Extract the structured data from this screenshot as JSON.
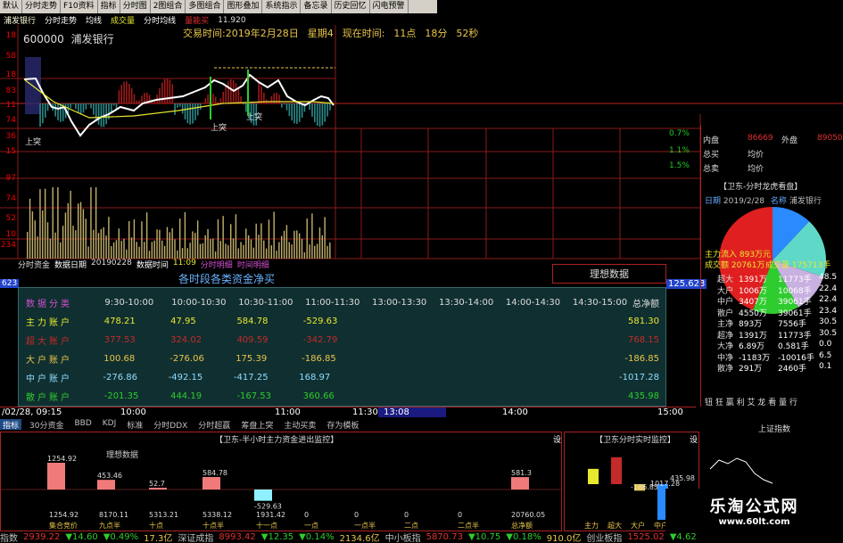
{
  "menu": [
    "默认",
    "分时走势",
    "F10资料",
    "指标",
    "分时图",
    "2图组合",
    "多图组合",
    "图形叠加",
    "系统指示",
    "备忘录",
    "历史回忆",
    "闪电预警"
  ],
  "titlebar": {
    "stock": "浦发银行",
    "items": [
      "分时走势",
      "均线",
      "成交量",
      "分时均线",
      "量能买"
    ],
    "price": "11.920"
  },
  "stock": {
    "code": "600000",
    "name": "浦发银行"
  },
  "tradeinfo": {
    "date_label": "交易时间:2019年2月28日",
    "weekday": "星期4",
    "now_label": "现在时间:",
    "hour": "11点",
    "minute": "18分",
    "second": "52秒"
  },
  "left_axis": [
    "18",
    "58",
    "18",
    "83",
    "11",
    "74",
    "36",
    "15",
    "97",
    "74",
    "52",
    "10",
    "234"
  ],
  "pct_labels": [
    "0.7%",
    "1.1%",
    "1.5%"
  ],
  "annot": {
    "up1": "上突",
    "up2": "上突",
    "up3": "上突"
  },
  "subheader": {
    "item1": "分时资金",
    "item2": "数据日期",
    "date": "20190228",
    "item3": "数据时间",
    "time": "11:09",
    "item4": "分时明细",
    "item5": "时间明细"
  },
  "ideal_data": "理想数据",
  "flag_left": "623",
  "flag_right": "125.623",
  "dialog": {
    "title": "各时段各类资金净买",
    "headers": [
      "数据分类",
      "9:30-10:00",
      "10:00-10:30",
      "10:30-11:00",
      "11:00-11:30",
      "13:00-13:30",
      "13:30-14:00",
      "14:00-14:30",
      "14:30-15:00",
      "总净额"
    ],
    "rows": [
      {
        "label": "主力账户",
        "values": [
          "478.21",
          "47.95",
          "584.78",
          "-529.63",
          "",
          "",
          "",
          "",
          "581.30"
        ],
        "color": "#e8e830"
      },
      {
        "label": "超大账户",
        "values": [
          "377.53",
          "324.02",
          "409.59",
          "-342.79",
          "",
          "",
          "",
          "",
          "768.15"
        ],
        "color": "#c42a2a"
      },
      {
        "label": "大户账户",
        "values": [
          "100.68",
          "-276.06",
          "175.39",
          "-186.85",
          "",
          "",
          "",
          "",
          "-186.85"
        ],
        "color": "#e8c64a"
      },
      {
        "label": "中户账户",
        "values": [
          "-276.86",
          "-492.15",
          "-417.25",
          "168.97",
          "",
          "",
          "",
          "",
          "-1017.28"
        ],
        "color": "#8fdcff"
      },
      {
        "label": "散户账户",
        "values": [
          "-201.35",
          "444.19",
          "-167.53",
          "360.66",
          "",
          "",
          "",
          "",
          "435.98"
        ],
        "color": "#2ecc2e"
      }
    ]
  },
  "time_axis": {
    "start": "/02/28, 09:15",
    "t1": "10:00",
    "t2": "11:00",
    "t3": "11:30",
    "t4": "13:08",
    "t5": "14:00",
    "t6": "15:00"
  },
  "tabs": [
    "指标",
    "30分资金",
    "BBD",
    "KDJ",
    "标准",
    "分时DDX",
    "分时超赢",
    "筹盘上突",
    "主动买卖",
    "存为模板"
  ],
  "bottom_left": {
    "title": "【卫东-半小时主力资金进出监控】",
    "ideal": "理想数据",
    "bars": [
      "1254.92",
      "453.46",
      "52.7",
      "584.78",
      "-529.63",
      "581.3"
    ],
    "foot_values": [
      "1254.92",
      "8170.11",
      "5313.21",
      "5338.12",
      "1931.42",
      "0",
      "0",
      "0",
      "0",
      "20760.05"
    ],
    "foot_labels": [
      "集合竞价",
      "九点半",
      "十点",
      "十点半",
      "十一点",
      "一点",
      "一点半",
      "二点",
      "二点半",
      "总净额"
    ]
  },
  "bottom_mid": {
    "title": "【卫东分时实时监控】",
    "bars": [
      "435.98",
      "-186.85",
      "1017.28"
    ],
    "foot_labels": [
      "主力",
      "超大",
      "大户",
      "中户"
    ]
  },
  "right_panel": {
    "top_rows": [
      [
        "内盘",
        "86669",
        "外盘",
        "89050"
      ],
      [
        "总买",
        "均价"
      ],
      [
        "总卖",
        "均价"
      ]
    ],
    "title": "【卫东-分时龙虎看盘】",
    "date_label": "日期",
    "date": "2019/2/28",
    "name_label": "名称",
    "name": "浦发银行",
    "main_in": "主力流入 893万元",
    "deal": "成交额 20761万",
    "deal_vol": "成交量 175713手",
    "list": [
      [
        "超大",
        "1391万",
        "11773手",
        "48.5"
      ],
      [
        "大户",
        "1006万",
        "10068手",
        "22.4"
      ],
      [
        "中户",
        "3407万",
        "39061手",
        "22.4"
      ],
      [
        "散户",
        "4550万",
        "39061手",
        "23.4"
      ],
      [
        "主净",
        "893万",
        "7556手",
        "30.5"
      ],
      [
        "超净",
        "1391万",
        "11773手",
        "30.5"
      ],
      [
        "大净",
        "6.89万",
        "0.581手",
        "0.0"
      ],
      [
        "中净",
        "-1183万",
        "-10016手",
        "6.5"
      ],
      [
        "散净",
        "291万",
        "2460手",
        "0.1"
      ]
    ],
    "footer": "钮 狂 赢 利 艾 龙 看 量 行",
    "index": "上证指数"
  },
  "status": [
    {
      "t": "指数",
      "c": "#c0c0c0"
    },
    {
      "t": "2939.22",
      "c": "#e03030"
    },
    {
      "t": "▼14.60",
      "c": "#2ecc2e"
    },
    {
      "t": "▼0.49%",
      "c": "#2ecc2e"
    },
    {
      "t": "17.3亿",
      "c": "#e8c64a"
    },
    {
      "t": "深证成指",
      "c": "#c0c0c0"
    },
    {
      "t": "8993.42",
      "c": "#e03030"
    },
    {
      "t": "▼12.35",
      "c": "#2ecc2e"
    },
    {
      "t": "▼0.14%",
      "c": "#2ecc2e"
    },
    {
      "t": "2134.6亿",
      "c": "#e8c64a"
    },
    {
      "t": "中小板指",
      "c": "#c0c0c0"
    },
    {
      "t": "5870.73",
      "c": "#e03030"
    },
    {
      "t": "▼10.75",
      "c": "#2ecc2e"
    },
    {
      "t": "▼0.18%",
      "c": "#2ecc2e"
    },
    {
      "t": "910.0亿",
      "c": "#e8c64a"
    },
    {
      "t": "创业板指",
      "c": "#c0c0c0"
    },
    {
      "t": "1525.02",
      "c": "#e03030"
    },
    {
      "t": "▼4.62",
      "c": "#2ecc2e"
    }
  ],
  "logo": {
    "title": "乐淘公式网",
    "url": "www.60lt.com"
  }
}
